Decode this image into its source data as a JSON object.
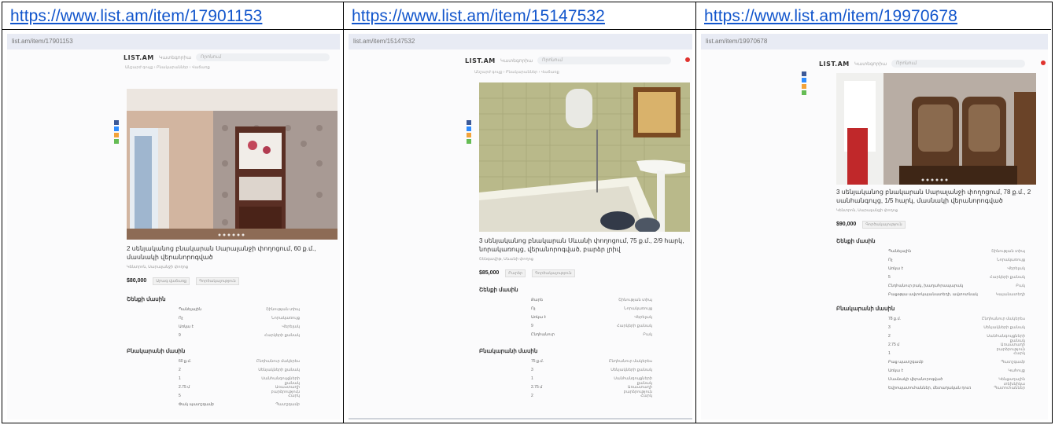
{
  "columns": [
    {
      "link": "https://www.list.am/item/17901153",
      "url_bar": "list.am/item/17901153",
      "logo": "LIST.AM",
      "category": "Կատեգորիա",
      "search_placeholder": "Որոնում",
      "breadcrumb": "Անշարժ գույք › Բնակարաններ › Վաճառք",
      "title": "2 սենյականոց բնակարան Սարալանջի փողոցում, 60 ք.մ., մասնակի վերանորոգված",
      "location": "Կենտրոն, Սարալանջի փողոց",
      "price": "$80,000",
      "tags": [
        "Արագ վաճառք",
        "Գործակալություն"
      ],
      "section1": "Շենքի մասին",
      "props1": [
        {
          "k": "Շինության տիպ",
          "v": "Պանելային"
        },
        {
          "k": "Նորակառույց",
          "v": "Ոչ"
        },
        {
          "k": "Վերելակ",
          "v": "Առկա է"
        },
        {
          "k": "Հարկերի քանակ",
          "v": "9"
        }
      ],
      "section2": "Բնակարանի մասին",
      "props2": [
        {
          "k": "Ընդհանուր մակերես",
          "v": "60 ք.մ."
        },
        {
          "k": "Սենյակների քանակ",
          "v": "2"
        },
        {
          "k": "Սանհանգույցների քանակ",
          "v": "1"
        },
        {
          "k": "Առաստաղի բարձրություն",
          "v": "2.75 մ"
        },
        {
          "k": "Հարկ",
          "v": "5"
        },
        {
          "k": "Պատշգամբ",
          "v": "Փակ պատշգամբ"
        }
      ]
    },
    {
      "link": "https://www.list.am/item/15147532",
      "url_bar": "list.am/item/15147532",
      "logo": "LIST.AM",
      "category": "Կատեգորիա",
      "search_placeholder": "Որոնում",
      "breadcrumb": "Անշարժ գույք › Բնակարաններ › Վաճառք",
      "title": "3 սենյականոց բնակարան Սևանի փողոցում, 75 ք.մ., 2/9 հարկ, նորակառույց, վերանորոգված, բարձր լրիվ",
      "location": "Շենգավիթ, Սևանի փողոց",
      "price": "$85,000",
      "tags": [
        "Բարձր",
        "Գործակալություն"
      ],
      "section1": "Շենքի մասին",
      "props1": [
        {
          "k": "Շինության տիպ",
          "v": "Քարե"
        },
        {
          "k": "Նորակառույց",
          "v": "Ոչ"
        },
        {
          "k": "Վերելակ",
          "v": "Առկա է"
        },
        {
          "k": "Հարկերի քանակ",
          "v": "9"
        },
        {
          "k": "Բակ",
          "v": "Ընդհանուր"
        }
      ],
      "section2": "Բնակարանի մասին",
      "props2": [
        {
          "k": "Ընդհանուր մակերես",
          "v": "75 ք.մ."
        },
        {
          "k": "Սենյակների քանակ",
          "v": "3"
        },
        {
          "k": "Սանհանգույցների քանակ",
          "v": "1"
        },
        {
          "k": "Առաստաղի բարձրություն",
          "v": "2.75 մ"
        },
        {
          "k": "Հարկ",
          "v": "2"
        }
      ]
    },
    {
      "link": "https://www.list.am/item/19970678",
      "url_bar": "list.am/item/19970678",
      "logo": "LIST.AM",
      "category": "Կատեգորիա",
      "search_placeholder": "Որոնում",
      "breadcrumb": "",
      "title": "3 սենյականոց բնակարան Սարալանջի փողոցում, 78 ք.մ., 2 սանհանգույց, 1/5 հարկ, մասնակի վերանորոգված",
      "location": "Կենտրոն, Սարալանջի փողոց",
      "price": "$90,000",
      "tags": [
        "Գործակալություն"
      ],
      "section1": "Շենքի մասին",
      "props1": [
        {
          "k": "Շինության տիպ",
          "v": "Պանելային"
        },
        {
          "k": "Նորակառույց",
          "v": "Ոչ"
        },
        {
          "k": "Վերելակ",
          "v": "Առկա է"
        },
        {
          "k": "Հարկերի քանակ",
          "v": "5"
        },
        {
          "k": "Բակ",
          "v": "Ընդհանուր բակ, խաղահրապարակ"
        },
        {
          "k": "Կայանատեղի",
          "v": "Բացօթյա ավտոկայանատեղի, ավտոտնակ"
        }
      ],
      "section2": "Բնակարանի մասին",
      "props2": [
        {
          "k": "Ընդհանուր մակերես",
          "v": "78 ք.մ."
        },
        {
          "k": "Սենյակների քանակ",
          "v": "3"
        },
        {
          "k": "Սանհանգույցների քանակ",
          "v": "2"
        },
        {
          "k": "Առաստաղի բարձրություն",
          "v": "2.75 մ"
        },
        {
          "k": "Հարկ",
          "v": "1"
        },
        {
          "k": "Պատշգամբ",
          "v": "Բաց պատշգամբ"
        },
        {
          "k": "Կահույք",
          "v": "Առկա է"
        },
        {
          "k": "Կենցաղային տեխնիկա",
          "v": "Մասնակի վերանորոգված"
        },
        {
          "k": "Պատուհաններ",
          "v": "Եվրոպատուհաններ, մետաղական դուռ"
        }
      ]
    }
  ],
  "colors": {
    "link": "#1155cc",
    "url_bar_bg": "#e8ebf4",
    "logo_dot": "#e0332e",
    "share_icons": [
      "#3b5998",
      "#2d8cff",
      "#f2a33a",
      "#65bc54"
    ]
  }
}
